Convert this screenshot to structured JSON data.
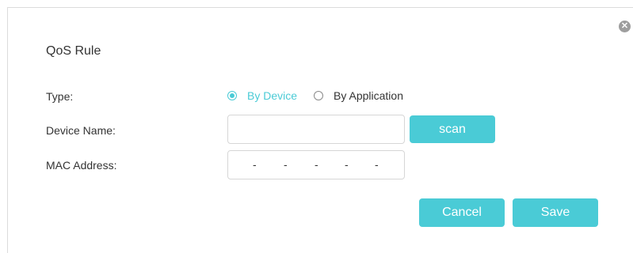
{
  "dialog": {
    "title": "QoS Rule",
    "close_icon": "close-icon"
  },
  "form": {
    "type_label": "Type:",
    "type_options": [
      {
        "label": "By Device",
        "selected": true
      },
      {
        "label": "By Application",
        "selected": false
      }
    ],
    "device_name_label": "Device Name:",
    "device_name_value": "",
    "scan_label": "scan",
    "mac_label": "MAC Address:",
    "mac_separators": [
      "-",
      "-",
      "-",
      "-",
      "-"
    ]
  },
  "actions": {
    "cancel_label": "Cancel",
    "save_label": "Save"
  },
  "colors": {
    "accent": "#4acbd6",
    "text": "#333333",
    "border": "#d6d6d6"
  }
}
